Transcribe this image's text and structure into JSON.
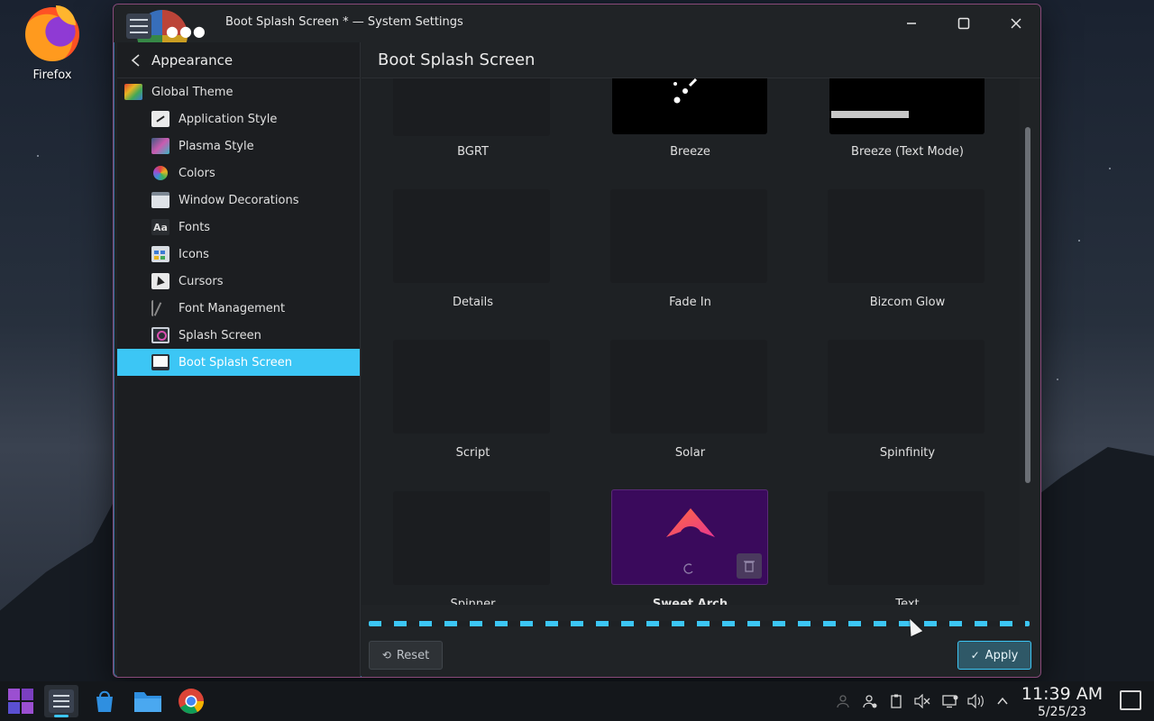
{
  "desktop": {
    "icons": [
      {
        "label": "Firefox",
        "icon": "firefox-icon"
      }
    ]
  },
  "window": {
    "title": "Boot Splash Screen * — System Settings",
    "controls": [
      "minimize-icon",
      "maximize-icon",
      "close-icon"
    ]
  },
  "sidebar": {
    "back_label": "Appearance",
    "top_item": {
      "label": "Global Theme",
      "icon": "global-theme-icon"
    },
    "items": [
      {
        "label": "Application Style",
        "icon": "application-style-icon"
      },
      {
        "label": "Plasma Style",
        "icon": "plasma-style-icon"
      },
      {
        "label": "Colors",
        "icon": "colors-icon"
      },
      {
        "label": "Window Decorations",
        "icon": "window-decorations-icon"
      },
      {
        "label": "Fonts",
        "icon": "fonts-icon",
        "glyph": "Aa"
      },
      {
        "label": "Icons",
        "icon": "icons-icon"
      },
      {
        "label": "Cursors",
        "icon": "cursors-icon"
      },
      {
        "label": "Font Management",
        "icon": "font-management-icon"
      },
      {
        "label": "Splash Screen",
        "icon": "splash-screen-icon"
      },
      {
        "label": "Boot Splash Screen",
        "icon": "boot-splash-icon",
        "active": true
      }
    ],
    "active_color": "#3cc6f5"
  },
  "main": {
    "title": "Boot Splash Screen",
    "themes": [
      {
        "label": "BGRT"
      },
      {
        "label": "Breeze"
      },
      {
        "label": "Breeze (Text Mode)"
      },
      {
        "label": "Details"
      },
      {
        "label": "Fade In"
      },
      {
        "label": "Bizcom Glow"
      },
      {
        "label": "Script"
      },
      {
        "label": "Solar"
      },
      {
        "label": "Spinfinity"
      },
      {
        "label": "Spinner"
      },
      {
        "label": "Sweet Arch",
        "selected": true
      },
      {
        "label": "Text"
      }
    ],
    "reset_label": "Reset",
    "apply_label": "Apply"
  },
  "taskbar": {
    "apps": [
      "app-launcher-icon",
      "system-settings-icon",
      "discover-icon",
      "file-manager-icon",
      "chrome-icon"
    ],
    "tray": [
      "user-icon",
      "account-icon",
      "clipboard-icon",
      "mute-icon",
      "network-icon",
      "volume-icon",
      "expand-tray-icon"
    ],
    "time": "11:39 AM",
    "date": "5/25/23"
  },
  "colors": {
    "accent": "#3cc6f5",
    "window_bg": "#202326",
    "sweet_arch_bg": "#3a0a5c"
  }
}
